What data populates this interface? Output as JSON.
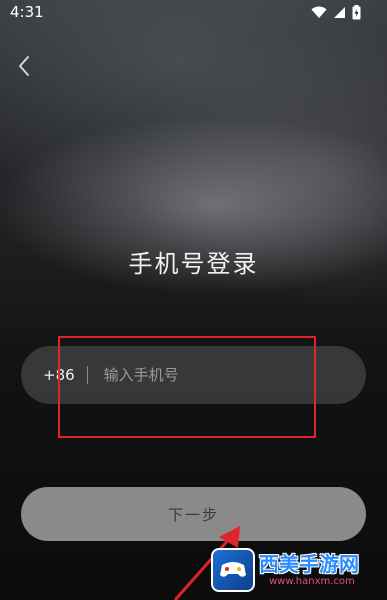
{
  "status_bar": {
    "time": "4:31",
    "icons": [
      "wifi-icon",
      "signal-icon",
      "battery-icon"
    ]
  },
  "header": {
    "back_icon": "chevron-left-icon"
  },
  "main": {
    "title": "手机号登录",
    "phone_field": {
      "country_code": "+86",
      "placeholder": "输入手机号",
      "value": ""
    },
    "next_button_label": "下一步"
  },
  "watermark": {
    "name": "西美手游网",
    "url": "www.hanxm.com"
  },
  "colors": {
    "highlight": "#e0242b",
    "button_bg": "#8a8a8a",
    "field_bg": "#464648"
  }
}
